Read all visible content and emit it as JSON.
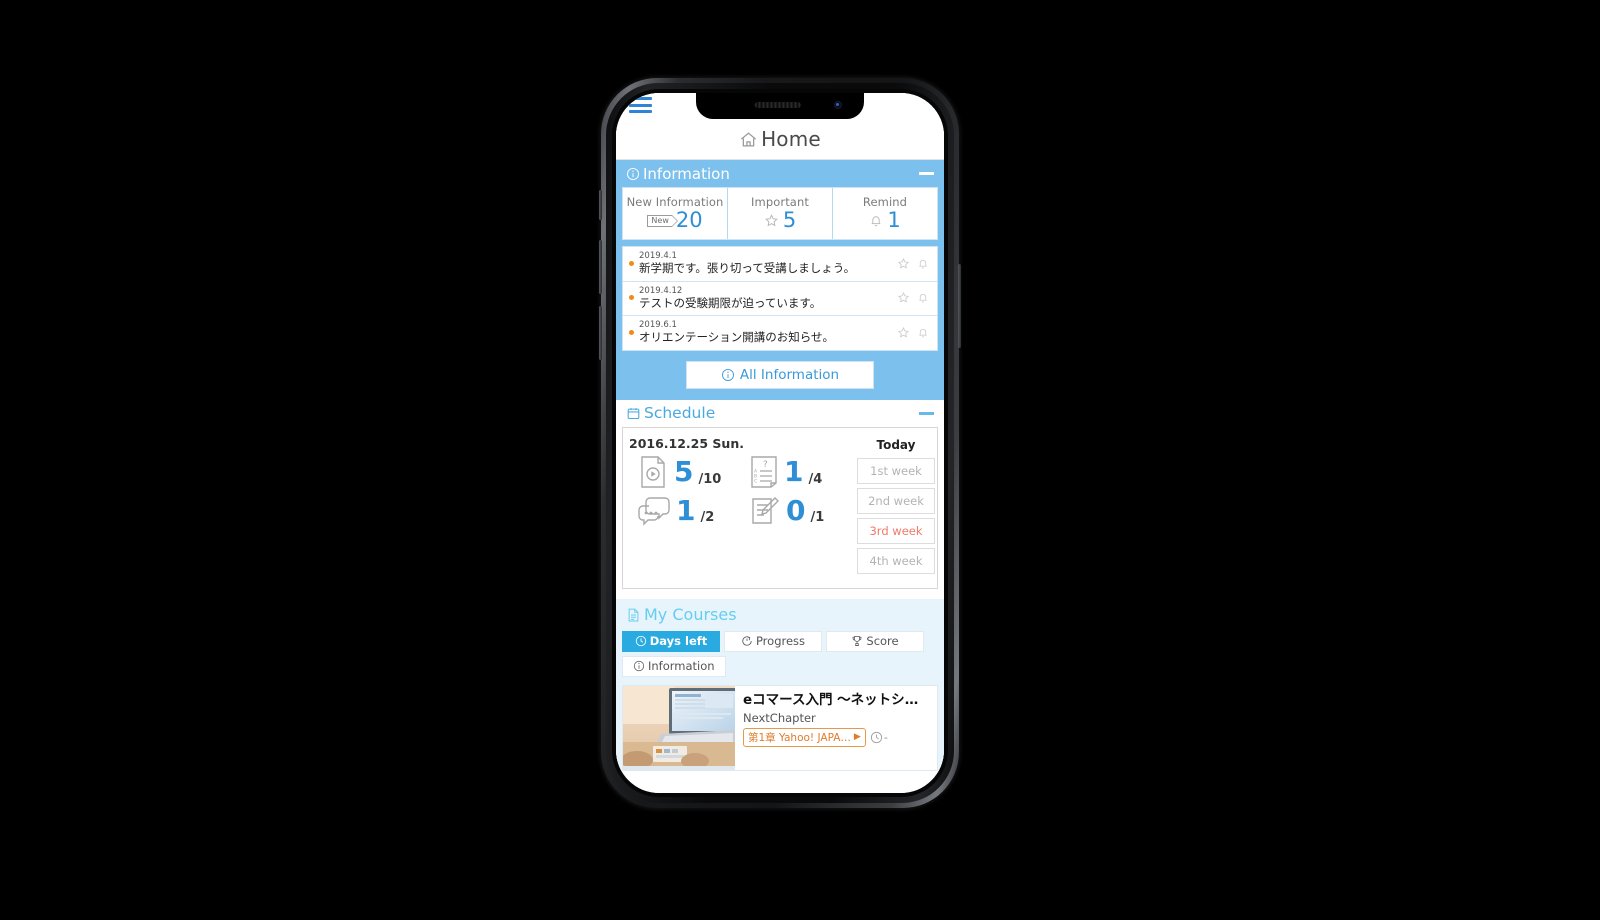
{
  "app": {
    "title": "Home",
    "menu_icon": "hamburger-menu-icon",
    "home_icon": "home-icon"
  },
  "information": {
    "header": "Information",
    "header_icon": "info-circle-icon",
    "collapse_icon": "minus-icon",
    "cards": [
      {
        "label": "New Information",
        "value": "20",
        "badge": "New",
        "icon": "new-tag-icon"
      },
      {
        "label": "Important",
        "value": "5",
        "icon": "star-icon"
      },
      {
        "label": "Remind",
        "value": "1",
        "icon": "bell-icon"
      }
    ],
    "items": [
      {
        "date": "2019.4.1",
        "message": "新学期です。張り切って受講しましょう。"
      },
      {
        "date": "2019.4.12",
        "message": "テストの受験期限が迫っています。"
      },
      {
        "date": "2019.6.1",
        "message": "オリエンテーション開講のお知らせ。"
      }
    ],
    "all_button": "All Information"
  },
  "schedule": {
    "header": "Schedule",
    "header_icon": "calendar-icon",
    "collapse_icon": "minus-icon",
    "date": "2016.12.25 Sun.",
    "today_label": "Today",
    "counters": [
      {
        "icon": "video-lesson-icon",
        "done": "5",
        "total": "/10"
      },
      {
        "icon": "quiz-test-icon",
        "done": "1",
        "total": "/4"
      },
      {
        "icon": "discussion-icon",
        "done": "1",
        "total": "/2"
      },
      {
        "icon": "report-icon",
        "done": "0",
        "total": "/1"
      }
    ],
    "weeks": [
      {
        "label": "1st week",
        "active": false
      },
      {
        "label": "2nd week",
        "active": false
      },
      {
        "label": "3rd week",
        "active": true
      },
      {
        "label": "4th week",
        "active": false
      }
    ]
  },
  "my_courses": {
    "header": "My Courses",
    "header_icon": "document-icon",
    "tabs": [
      {
        "label": "Days left",
        "icon": "clock-icon",
        "active": true
      },
      {
        "label": "Progress",
        "icon": "progress-icon",
        "active": false
      },
      {
        "label": "Score",
        "icon": "trophy-icon",
        "active": false
      },
      {
        "label": "Information",
        "icon": "info-circle-icon",
        "active": false
      }
    ],
    "courses": [
      {
        "title": "eコマース入門 ～ネットショ…",
        "provider": "NextChapter",
        "chapter": "第1章 Yahoo! JAPA…",
        "days_left": "-",
        "thumbnail": "laptop-desk-photo"
      }
    ]
  },
  "colors": {
    "info_panel": "#7cc0ee",
    "accent_blue": "#2e8fd6",
    "cyan": "#29abe2",
    "light_cyan_bg": "#e7f4fc",
    "active_week": "#f07a68",
    "orange_dot": "#f08a18",
    "chapter_orange": "#e07b2a"
  }
}
